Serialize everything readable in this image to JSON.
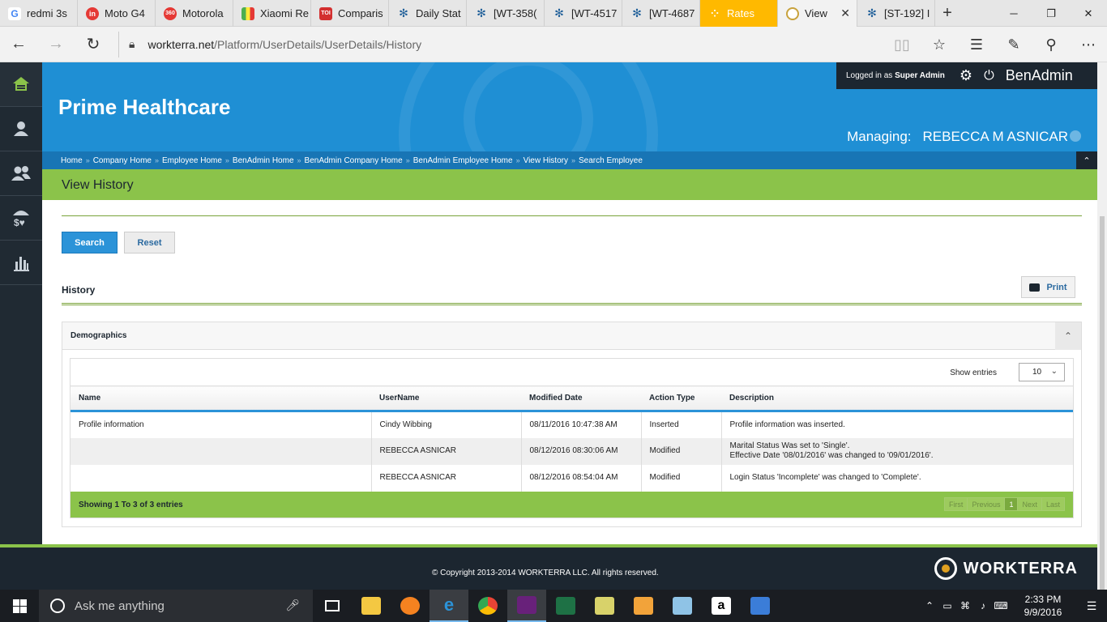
{
  "browser": {
    "tabs": [
      {
        "label": "redmi 3s",
        "icon": "google-icon",
        "color": "#ffffff"
      },
      {
        "label": "Moto G4",
        "icon": "in-icon",
        "color": "#e53935"
      },
      {
        "label": "Motorola",
        "icon": "360-icon",
        "color": "#e53935"
      },
      {
        "label": "Xiaomi Re",
        "icon": "flag-icon",
        "color": "#4caf50"
      },
      {
        "label": "Comparis",
        "icon": "toi-icon",
        "color": "#d32f2f"
      },
      {
        "label": "Daily Stat",
        "icon": "jira-icon",
        "color": "#1f5f99"
      },
      {
        "label": "[WT-358(",
        "icon": "jira-icon",
        "color": "#1f5f99"
      },
      {
        "label": "[WT-4517",
        "icon": "jira-icon",
        "color": "#1f5f99"
      },
      {
        "label": "[WT-4687",
        "icon": "jira-icon",
        "color": "#1f5f99"
      },
      {
        "label": "Rates",
        "icon": "rates-icon",
        "color": "#ffb900"
      },
      {
        "label": "View",
        "icon": "workterra-icon",
        "color": "#c8a23c",
        "close": "✕"
      },
      {
        "label": "[ST-192] I",
        "icon": "jira-icon",
        "color": "#1f5f99"
      }
    ],
    "new_tab": "+",
    "url_domain": "workterra.net",
    "url_path": "/Platform/UserDetails/UserDetails/History"
  },
  "sidebar": {
    "items": [
      {
        "icon": "home-icon"
      },
      {
        "icon": "user-icon"
      },
      {
        "icon": "users-icon"
      },
      {
        "icon": "benefits-icon"
      },
      {
        "icon": "reports-icon"
      }
    ]
  },
  "header": {
    "company": "Prime Healthcare",
    "logged_in_prefix": "Logged in as",
    "logged_in_role": "Super Admin",
    "app_name": "BenAdmin",
    "managing_label": "Managing:",
    "managing_name": "REBECCA M ASNICAR",
    "breadcrumbs": [
      "Home",
      "Company Home",
      "Employee Home",
      "BenAdmin Home",
      "BenAdmin Company Home",
      "BenAdmin Employee Home",
      "View History",
      "Search Employee"
    ],
    "breadcrumb_sep": "»",
    "collapse_icon": "⌃"
  },
  "page": {
    "title": "View History",
    "search_label": "Search",
    "reset_label": "Reset",
    "history_label": "History",
    "print_label": "Print"
  },
  "panel": {
    "title": "Demographics",
    "show_entries_label": "Show entries",
    "page_size": "10",
    "columns": [
      "Name",
      "UserName",
      "Modified Date",
      "Action Type",
      "Description"
    ],
    "rows": [
      {
        "name": "Profile information",
        "user": "Cindy Wibbing",
        "date": "08/11/2016 10:47:38 AM",
        "action": "Inserted",
        "desc1": "Profile information was inserted.",
        "desc2": ""
      },
      {
        "name": "",
        "user": "REBECCA ASNICAR",
        "date": "08/12/2016 08:30:06 AM",
        "action": "Modified",
        "desc1": "Marital Status Was set to 'Single'.",
        "desc2": "Effective Date '08/01/2016' was changed to '09/01/2016'."
      },
      {
        "name": "",
        "user": "REBECCA ASNICAR",
        "date": "08/12/2016 08:54:04 AM",
        "action": "Modified",
        "desc1": "Login Status 'Incomplete' was changed to 'Complete'.",
        "desc2": ""
      }
    ],
    "showing": "Showing 1 To 3 of 3 entries",
    "pager": {
      "first": "First",
      "previous": "Previous",
      "current": "1",
      "next": "Next",
      "last": "Last"
    }
  },
  "footer": {
    "copyright": "© Copyright 2013-2014 WORKTERRA LLC. All rights reserved.",
    "logo_text": "WORKTERRA"
  },
  "taskbar": {
    "search_placeholder": "Ask me anything",
    "time": "2:33 PM",
    "date": "9/9/2016"
  },
  "colors": {
    "accent_blue": "#1f8fd4",
    "accent_green": "#8bc34a",
    "dark": "#1c2630"
  }
}
